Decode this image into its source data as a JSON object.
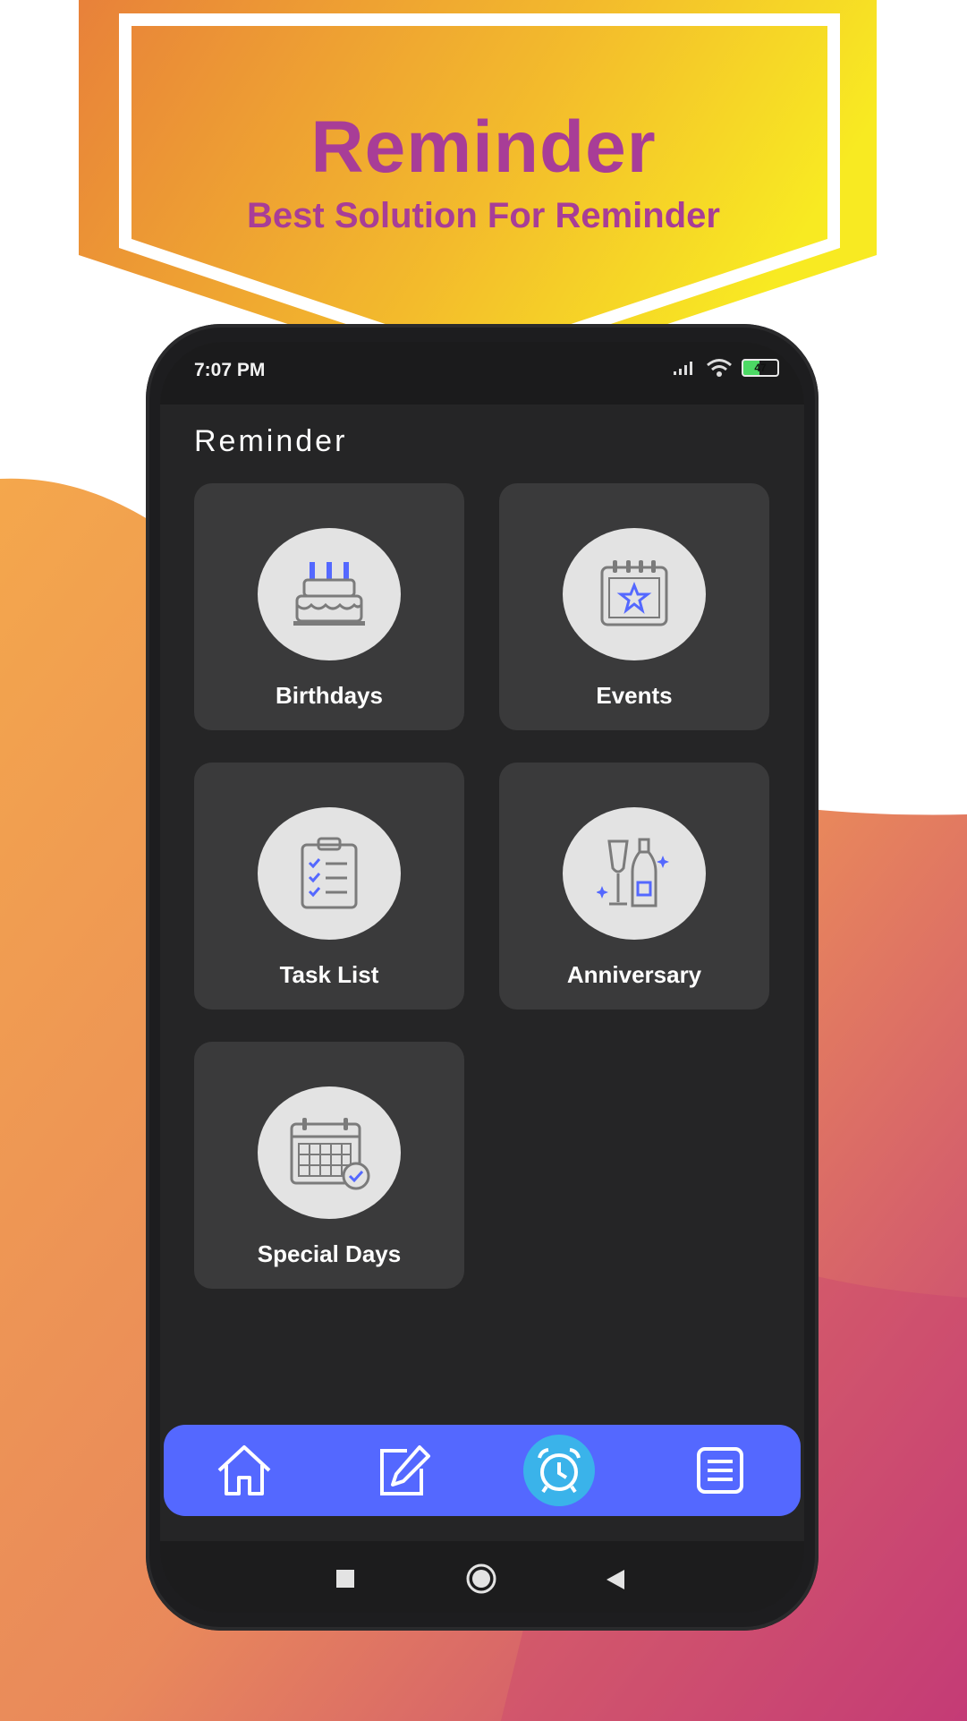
{
  "banner": {
    "title": "Reminder",
    "subtitle": "Best Solution For Reminder"
  },
  "statusbar": {
    "time": "7:07 PM",
    "battery": "47",
    "icons": [
      "signal-icon",
      "wifi-icon",
      "battery-icon"
    ]
  },
  "app": {
    "title": "Reminder"
  },
  "cards": [
    {
      "label": "Birthdays",
      "icon": "birthday-cake-icon"
    },
    {
      "label": "Events",
      "icon": "calendar-star-icon"
    },
    {
      "label": "Task List",
      "icon": "clipboard-checklist-icon"
    },
    {
      "label": "Anniversary",
      "icon": "champagne-icon"
    },
    {
      "label": "Special Days",
      "icon": "calendar-check-icon"
    }
  ],
  "bottom_nav": {
    "items": [
      "home-icon",
      "edit-icon",
      "alarm-clock-icon",
      "list-icon"
    ],
    "active": "alarm-clock-icon"
  },
  "system_nav": [
    "recents-icon",
    "home-circle-icon",
    "back-icon"
  ],
  "colors": {
    "accent": "#5468ff",
    "active": "#3ab3ea",
    "title_text": "#a83d97",
    "card": "#3a3a3b",
    "screen": "#252526"
  }
}
